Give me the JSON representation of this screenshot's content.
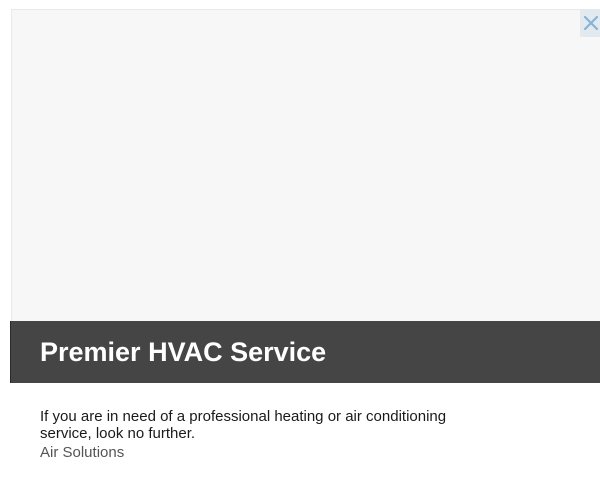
{
  "ad": {
    "close_icon": "close-x-icon",
    "headline": "Premier HVAC Service",
    "description": "If you are in need of a professional heating or air conditioning service, look no further.",
    "advertiser": "Air Solutions"
  },
  "colors": {
    "title_band": "#454545",
    "image_placeholder": "#f7f7f7",
    "close_icon": "#8ab4d6"
  }
}
